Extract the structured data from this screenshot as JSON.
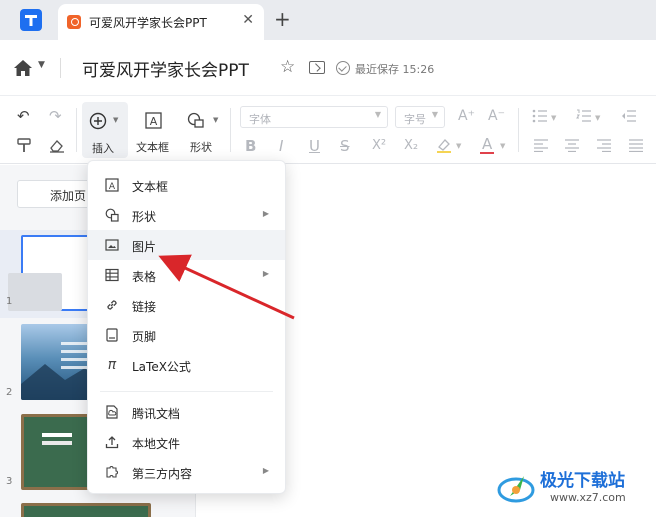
{
  "tabbar": {
    "tab_title": "可爱风开学家长会PPT",
    "close_glyph": "✕",
    "add_glyph": "+"
  },
  "titlebar": {
    "doc_title": "可爱风开学家长会PPT",
    "saved_text": "最近保存 15:26"
  },
  "toolbar": {
    "insert_label": "插入",
    "textbox_label": "文本框",
    "shape_label": "形状",
    "font_placeholder": "字体",
    "size_placeholder": "号",
    "size_prefix": "字",
    "bold": "B",
    "italic": "I",
    "underline": "U",
    "strike": "S",
    "superscript": "X²",
    "subscript": "X₂",
    "font_color": "A",
    "grow_font": "A⁺",
    "shrink_font": "A⁻"
  },
  "left_panel": {
    "add_page_label": "添加页",
    "slide_numbers": [
      "1",
      "2",
      "3"
    ]
  },
  "insert_menu": {
    "items": [
      {
        "label": "文本框",
        "icon": "textbox-icon",
        "submenu": false
      },
      {
        "label": "形状",
        "icon": "shape-icon",
        "submenu": true
      },
      {
        "label": "图片",
        "icon": "image-icon",
        "submenu": false
      },
      {
        "label": "表格",
        "icon": "table-icon",
        "submenu": true
      },
      {
        "label": "链接",
        "icon": "link-icon",
        "submenu": false
      },
      {
        "label": "页脚",
        "icon": "footer-icon",
        "submenu": false
      },
      {
        "label": "LaTeX公式",
        "icon": "pi-icon",
        "submenu": false
      },
      {
        "label": "腾讯文档",
        "icon": "tencent-docs-icon",
        "submenu": false
      },
      {
        "label": "本地文件",
        "icon": "upload-icon",
        "submenu": false
      },
      {
        "label": "第三方内容",
        "icon": "puzzle-icon",
        "submenu": true
      }
    ]
  },
  "watermark": {
    "title": "极光下载站",
    "url": "www.xz7.com"
  },
  "colors": {
    "accent": "#3a7bf5",
    "annotation_arrow": "#d9262a",
    "tab_bar_bg": "#e9ebef",
    "app_logo": "#1e6ff0",
    "tab_icon": "#f0642a"
  }
}
